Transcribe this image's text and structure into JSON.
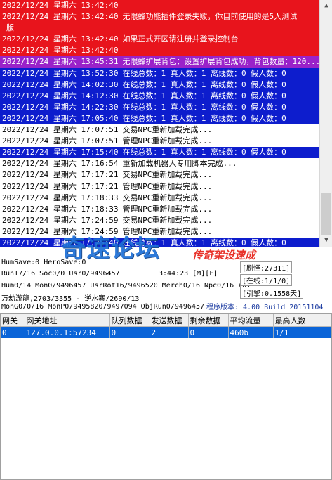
{
  "colors": {
    "red": "#e8141c",
    "blue": "#0d1dcd",
    "purple": "#9a22c9",
    "select": "#0a64d8"
  },
  "log": [
    {
      "ts": "2022/12/24 星期六 13:42:40",
      "msg": "",
      "style": "red"
    },
    {
      "ts": "2022/12/24 星期六 13:42:40",
      "msg": "无限蜂功能插件登录失败，你目前使用的是5人测试",
      "style": "red"
    },
    {
      "ts": "",
      "msg": "版",
      "style": "red"
    },
    {
      "ts": "2022/12/24 星期六 13:42:40",
      "msg": "如果正式开区请注册并登录控制台",
      "style": "red"
    },
    {
      "ts": "2022/12/24 星期六 13:42:40",
      "msg": "",
      "style": "red"
    },
    {
      "ts": "2022/12/24 星期六 13:45:31",
      "msg": "无限蜂扩展背包：设置扩展背包成功，背包数量：120...",
      "style": "purple"
    },
    {
      "ts": "2022/12/24 星期六 13:52:30",
      "msg": "在线总数：1 真人数：1 离线数：0 假人数：0",
      "style": "blue"
    },
    {
      "ts": "2022/12/24 星期六 14:02:30",
      "msg": "在线总数：1 真人数：1 离线数：0 假人数：0",
      "style": "blue"
    },
    {
      "ts": "2022/12/24 星期六 14:12:30",
      "msg": "在线总数：1 真人数：1 离线数：0 假人数：0",
      "style": "blue"
    },
    {
      "ts": "2022/12/24 星期六 14:22:30",
      "msg": "在线总数：1 真人数：1 离线数：0 假人数：0",
      "style": "blue"
    },
    {
      "ts": "2022/12/24 星期六 17:05:40",
      "msg": "在线总数：1 真人数：1 离线数：0 假人数：0",
      "style": "blue"
    },
    {
      "ts": "2022/12/24 星期六 17:07:51",
      "msg": "交易NPC重新加载完成...",
      "style": "plain"
    },
    {
      "ts": "2022/12/24 星期六 17:07:51",
      "msg": "管理NPC重新加载完成...",
      "style": "plain"
    },
    {
      "ts": "2022/12/24 星期六 17:15:40",
      "msg": "在线总数：1 真人数：1 离线数：0 假人数：0",
      "style": "blue"
    },
    {
      "ts": "2022/12/24 星期六 17:16:54",
      "msg": "重新加载机器人专用脚本完成...",
      "style": "plain"
    },
    {
      "ts": "2022/12/24 星期六 17:17:21",
      "msg": "交易NPC重新加载完成...",
      "style": "plain"
    },
    {
      "ts": "2022/12/24 星期六 17:17:21",
      "msg": "管理NPC重新加载完成...",
      "style": "plain"
    },
    {
      "ts": "2022/12/24 星期六 17:18:33",
      "msg": "交易NPC重新加载完成...",
      "style": "plain"
    },
    {
      "ts": "2022/12/24 星期六 17:18:33",
      "msg": "管理NPC重新加载完成...",
      "style": "plain"
    },
    {
      "ts": "2022/12/24 星期六 17:24:59",
      "msg": "交易NPC重新加载完成...",
      "style": "plain"
    },
    {
      "ts": "2022/12/24 星期六 17:24:59",
      "msg": "管理NPC重新加载完成...",
      "style": "plain"
    },
    {
      "ts": "2022/12/24 星期六 17:25:40",
      "msg": "在线总数：1 真人数：1 离线数：0 假人数：0",
      "style": "blue"
    }
  ],
  "watermark": {
    "big": "奇速论坛",
    "small": "传奇架设速成"
  },
  "status": {
    "humsave": "HumSave:0 HeroSave:0",
    "run": "Run17/16 Soc0/0 Usr0/9496457",
    "clock": "3:44:23 [M][F]",
    "brush_monster": "[刷怪:27311]",
    "hum": "Hum0/14 Mon0/9496457 UsrRot16/9496520 Merch0/16 Npc0/16 (0)",
    "online": "[在线:1/1/0]",
    "map": "万劫游龍,2703/3355 - 逆水寨/2690/13",
    "engine": "[引擎:0.1558天]",
    "mon": "MonG0/0/16 MonP0/9495820/9497094 ObjRun0/9496457",
    "version": "程序版本: 4.00 Build 20151104"
  },
  "grid": {
    "columns": [
      "网关",
      "网关地址",
      "队列数据",
      "发送数据",
      "剩余数据",
      "平均流量",
      "最高人数"
    ],
    "rows": [
      {
        "cells": [
          "0",
          "127.0.0.1:57234",
          "0",
          "2",
          "0",
          "460b",
          "1/1"
        ],
        "selected": true
      }
    ]
  }
}
